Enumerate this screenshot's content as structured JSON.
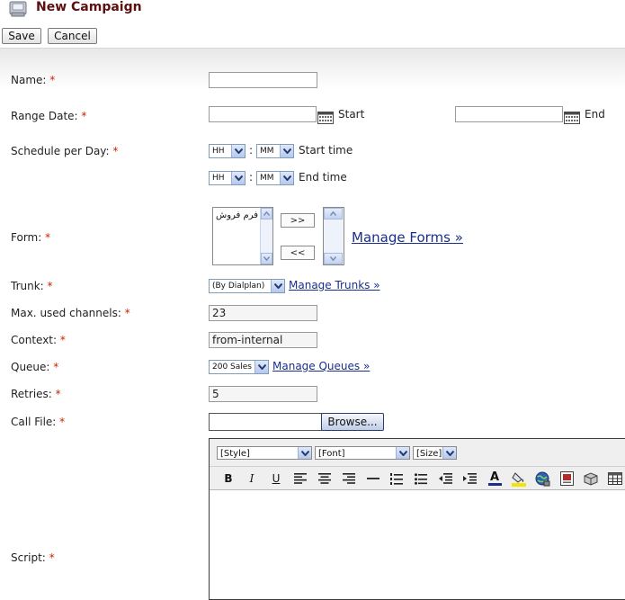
{
  "header": {
    "title": "New Campaign",
    "save_label": "Save",
    "cancel_label": "Cancel"
  },
  "form": {
    "name": {
      "label": "Name:",
      "value": ""
    },
    "range_date": {
      "label": "Range Date:",
      "start_value": "",
      "start_label": "Start",
      "end_value": "",
      "end_label": "End"
    },
    "schedule": {
      "label": "Schedule per Day:",
      "hh": "HH",
      "mm": "MM",
      "separator": ":",
      "start_time_label": "Start time",
      "end_time_label": "End time"
    },
    "form_field": {
      "label": "Form:",
      "available_items": [
        "فرم فروش"
      ],
      "add_label": ">>",
      "remove_label": "<<",
      "manage_link": "Manage Forms »"
    },
    "trunk": {
      "label": "Trunk:",
      "selected": "(By Dialplan)",
      "manage_link": "Manage Trunks »"
    },
    "max_channels": {
      "label": "Max. used channels:",
      "value": "23"
    },
    "context": {
      "label": "Context:",
      "value": "from-internal"
    },
    "queue": {
      "label": "Queue:",
      "selected": "200 Sales",
      "manage_link": "Manage Queues »"
    },
    "retries": {
      "label": "Retries:",
      "value": "5"
    },
    "call_file": {
      "label": "Call File:",
      "value": "",
      "browse_label": "Browse..."
    },
    "script": {
      "label": "Script:",
      "style_select": "[Style]",
      "font_select": "[Font]",
      "size_select": "[Size]",
      "toolbar_icons": [
        "bold-icon",
        "italic-icon",
        "underline-icon",
        "align-left-icon",
        "align-center-icon",
        "align-right-icon",
        "horizontal-rule-icon",
        "ordered-list-icon",
        "unordered-list-icon",
        "outdent-icon",
        "indent-icon",
        "text-color-icon",
        "highlight-icon",
        "link-icon",
        "image-icon",
        "package-icon",
        "table-icon"
      ],
      "bold_label": "B",
      "italic_label": "I",
      "underline_label": "U",
      "text_color_label": "A"
    },
    "required_mark": "*"
  },
  "colors": {
    "title": "#5c1010",
    "required": "#cc2200",
    "link": "#1a2f8a"
  }
}
